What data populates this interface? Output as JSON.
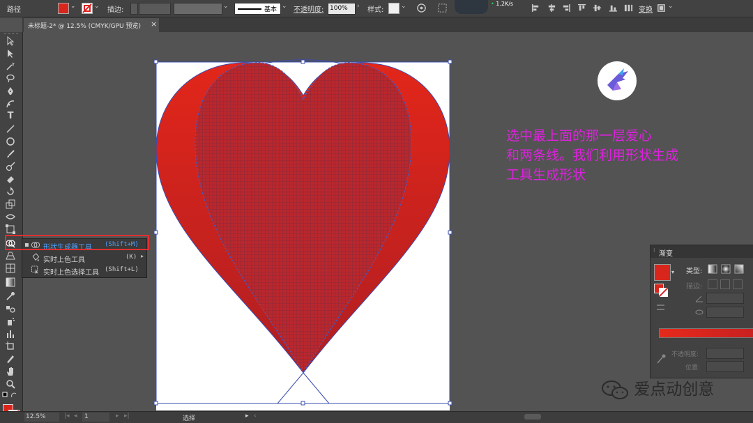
{
  "control_bar": {
    "object_type": "路径",
    "stroke_label": "描边:",
    "stroke_profile": "基本",
    "opacity_label": "不透明度:",
    "opacity_value": "100%",
    "style_label": "样式:",
    "network_speed": "1.2K/s",
    "transform_label": "变换",
    "fill_color": "#d9261c"
  },
  "document_tab": {
    "title": "未标题-2* @ 12.5% (CMYK/GPU 预览)",
    "close_glyph": "×"
  },
  "tool_flyout": {
    "items": [
      {
        "label": "形状生成器工具",
        "shortcut": "(Shift+M)",
        "selected": true
      },
      {
        "label": "实时上色工具",
        "shortcut": "(K)",
        "selected": false
      },
      {
        "label": "实时上色选择工具",
        "shortcut": "(Shift+L)",
        "selected": false
      }
    ],
    "highlight_color": "#e03030",
    "selected_text_color": "#4da3ff"
  },
  "annotation": {
    "lines": [
      "选中最上面的那一层爱心",
      "和两条线。我们利用形状生成",
      "工具生成形状"
    ],
    "color": "#e020e0"
  },
  "gradient_panel": {
    "title": "渐变",
    "type_label": "类型:",
    "stroke_label": "描边:",
    "opacity_label": "不透明度:",
    "location_label": "位置:",
    "gradient_start": "#e62a1c",
    "gradient_end": "#c82020"
  },
  "status_bar": {
    "zoom": "12.5%",
    "page": "1",
    "mode": "选择"
  },
  "watermark": {
    "text": "爱点动创意"
  },
  "artwork": {
    "heart_top_color": "#e2261a",
    "heart_bottom_color": "#b01e22",
    "path_color": "#3a4db0"
  }
}
